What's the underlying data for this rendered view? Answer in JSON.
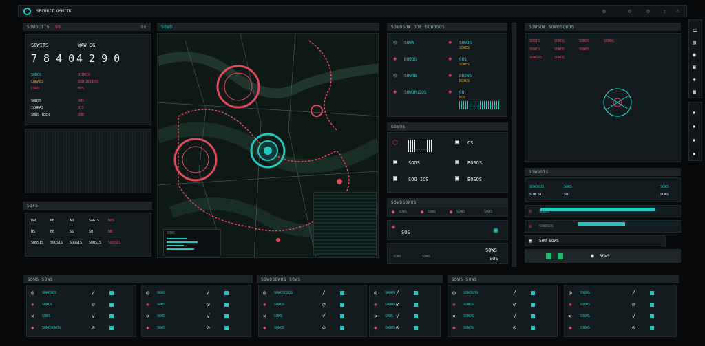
{
  "topbar": {
    "title": "SECURIT OSMITK",
    "icons": [
      "gear-icon",
      "user-icon",
      "user-icon",
      "upload-icon",
      "alert-icon"
    ]
  },
  "left": {
    "header": "SOWOCITS",
    "header_num": "90",
    "header_right": "86",
    "big_label_1": "SOWITS",
    "big_label_2": "WAW SG",
    "big_value_1": "7 8 4 0",
    "big_value_2": "4 2 9 0",
    "rows": [
      [
        "SOWOS",
        "BIMOIO"
      ],
      [
        "CORAES",
        "SOWIOOODOS"
      ],
      [
        "CORD",
        "BOS"
      ],
      [
        "SOWSS",
        "BOS"
      ],
      [
        "ICORAS",
        "BIS"
      ],
      [
        "SOWS TEER",
        "OOB"
      ]
    ],
    "footer_header": "SOFS",
    "table_rows": [
      [
        "BAL",
        "NB",
        "AO",
        "SAGIS",
        "BOS"
      ],
      [
        "NS",
        "B6",
        "SS",
        "SO",
        "BB"
      ],
      [
        "SOOSIS",
        "SOOSIS",
        "SOOSIS",
        "SOOSIS",
        "SOOSIS"
      ]
    ]
  },
  "map": {
    "title": "SOWD",
    "legend_title": "SOWS"
  },
  "alerts": {
    "header": "SOWOSOW ODE SOWOSOS",
    "items": [
      {
        "l1": "SOWA",
        "l2": "SOWOS",
        "l3": "SOWES"
      },
      {
        "l1": "BGBOS",
        "l2": "9OS",
        "l3": "SOWES"
      },
      {
        "l1": "SOWRB",
        "l2": "BROWS",
        "l3": "BOSOS"
      },
      {
        "l1": "SOWORUSOS",
        "l2": "9O",
        "l3": "BOS"
      }
    ]
  },
  "stats": {
    "header": "SOWOS",
    "rows": [
      {
        "a": "",
        "b": "OS"
      },
      {
        "a": "SOOS",
        "b": "BOSOS"
      },
      {
        "a": "SOO IOS",
        "b": "BOSOS"
      }
    ]
  },
  "mid_strip": {
    "header": "SOWOSOWOS",
    "items": [
      "SOWS",
      "SOWS",
      "SOWS",
      "SOWS",
      "SOWS"
    ],
    "sub_1": "SOS",
    "sub_2": "SOWS",
    "sub_3": "SOWS",
    "sub_4": "SOWS",
    "sub_5": "SOS"
  },
  "right": {
    "header": "SOWSOW SOWOSOWOS",
    "rows": [
      [
        "SOBIS",
        "SOWOS",
        "SOWOS",
        "SOWOS"
      ],
      [
        "SOWIS",
        "SOWOS",
        "SOWOS"
      ],
      [
        "SOWSOS",
        "SOWOS"
      ]
    ],
    "mid_header": "SOWOSIS",
    "mid_labels": [
      "SOWOSOS",
      "SOWS",
      "SOWS"
    ],
    "mid_labels_2": [
      "SOW STT",
      "SO",
      "SOWS"
    ],
    "bar_rows": [
      {
        "label": "SOWOS",
        "fill": 0.94
      },
      {
        "label": "SOWOSOS",
        "fill": 0.46
      }
    ],
    "bottom_1": "SOW SOWS",
    "bottom_2": "SOWS"
  },
  "bottom": {
    "headers": [
      "SOWS SOWS",
      "SOWOSOWOS SOWS",
      "SOWS SOWS"
    ],
    "blocks": [
      [
        [
          "SOWOSOS"
        ],
        [
          "SOWOS"
        ],
        [
          "SOWS"
        ],
        [
          "SOWOSOWOS"
        ]
      ],
      [
        [
          "SOWS"
        ],
        [
          "SOWS"
        ],
        [
          "SOWS"
        ],
        [
          "SOWS"
        ]
      ],
      [
        [
          "SOWOSOSOS"
        ],
        [
          "SOWOS"
        ],
        [
          "SOWS"
        ],
        [
          "SOWOS"
        ]
      ],
      [
        [
          "SOWOS"
        ],
        [
          "SOWOS"
        ],
        [
          "SOWS"
        ],
        [
          "SOWOS"
        ]
      ],
      [
        [
          "SOWOSOS"
        ],
        [
          "SOWOS"
        ],
        [
          "SOWOS"
        ],
        [
          "SOWOS"
        ]
      ],
      [
        [
          "SOWOS"
        ],
        [
          "SOWOS"
        ],
        [
          "SOWOS"
        ],
        [
          "SOWOS"
        ]
      ]
    ]
  },
  "colors": {
    "accent": "#22c7c0",
    "alert": "#e0495e",
    "bg": "#07090b",
    "panel": "#141b1f"
  }
}
